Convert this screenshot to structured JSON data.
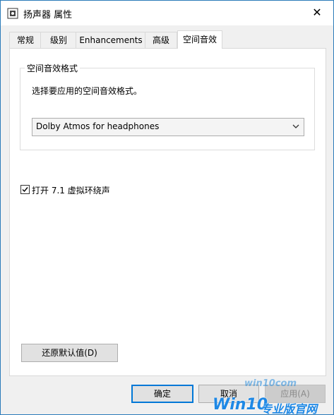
{
  "window": {
    "title": "扬声器 属性",
    "close_glyph": "✕"
  },
  "tabs": [
    {
      "label": "常规"
    },
    {
      "label": "级别"
    },
    {
      "label": "Enhancements"
    },
    {
      "label": "高级"
    },
    {
      "label": "空间音效"
    }
  ],
  "active_tab": "空间音效",
  "spatial": {
    "group_label": "空间音效格式",
    "hint": "选择要应用的空间音效格式。",
    "format_selected": "Dolby Atmos for headphones",
    "virtual_surround_label": "打开 7.1 虚拟环绕声",
    "virtual_surround_checked": true,
    "restore_button": "还原默认值(D)"
  },
  "footer": {
    "ok_label": "确定",
    "cancel_label": "取消",
    "apply_label": "应用(A)"
  },
  "watermark": {
    "url_text": "win10com",
    "brand_text": "Win10",
    "brand_suffix": "专业版官网"
  },
  "colors": {
    "accent": "#0078d7",
    "window_border": "#2b7bb9"
  }
}
